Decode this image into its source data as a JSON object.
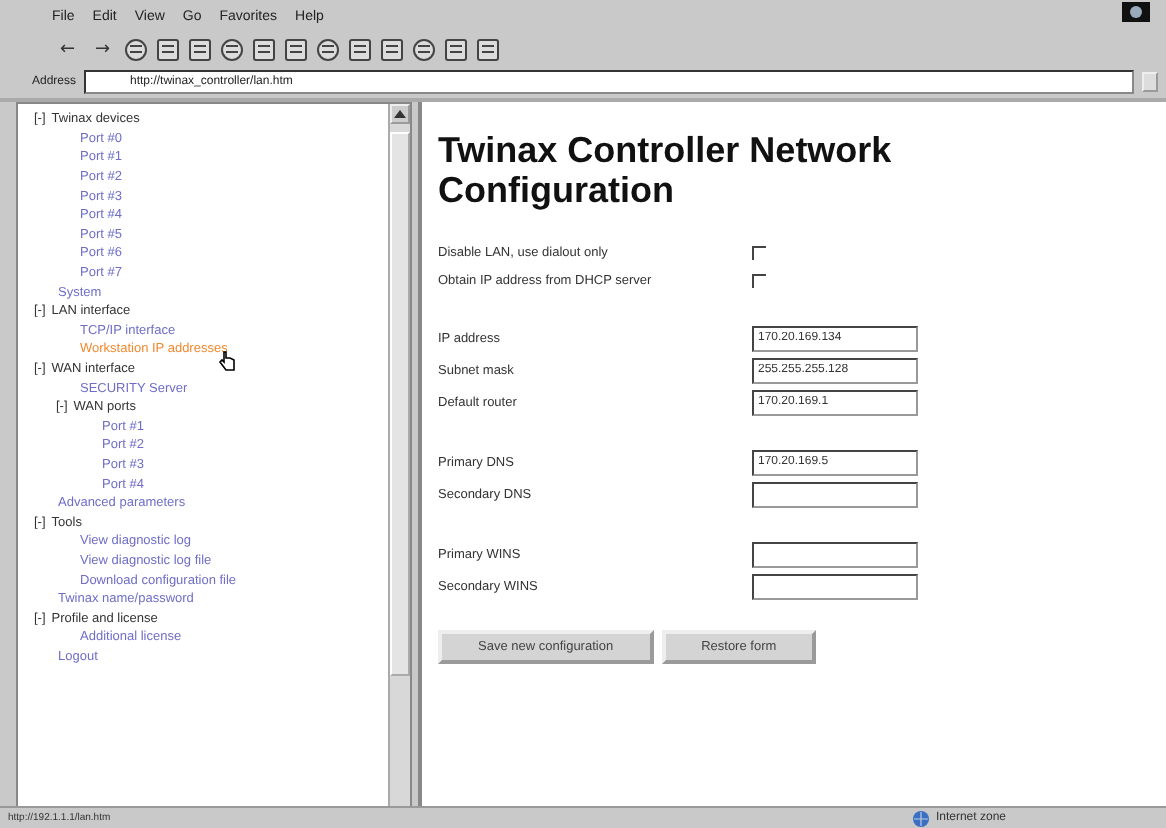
{
  "menu": [
    "File",
    "Edit",
    "View",
    "Go",
    "Favorites",
    "Help"
  ],
  "toolbar": {
    "back": "←",
    "forward": "→"
  },
  "address": {
    "label": "Address",
    "value": "http://twinax_controller/lan.htm"
  },
  "tree": [
    {
      "label": "Twinax devices",
      "toggle": "[-]",
      "selected": false,
      "children": [
        {
          "label": "Port #0",
          "selected": false
        },
        {
          "label": "Port #1",
          "selected": false
        },
        {
          "label": "Port #2",
          "selected": false
        },
        {
          "label": "Port #3",
          "selected": false
        },
        {
          "label": "Port #4",
          "selected": false
        },
        {
          "label": "Port #5",
          "selected": false
        },
        {
          "label": "Port #6",
          "selected": false
        },
        {
          "label": "Port #7",
          "selected": false
        }
      ]
    },
    {
      "label": "System",
      "selected": false
    },
    {
      "label": "LAN interface",
      "toggle": "[-]",
      "selected": false,
      "children": [
        {
          "label": "TCP/IP interface",
          "selected": false
        },
        {
          "label": "Workstation IP addresses",
          "selected": true
        }
      ]
    },
    {
      "label": "WAN interface",
      "toggle": "[-]",
      "selected": false,
      "children": [
        {
          "label": "SECURITY Server",
          "selected": false
        },
        {
          "label": "WAN ports",
          "toggle": "[-]",
          "selected": false,
          "children": [
            {
              "label": "Port #1",
              "selected": false
            },
            {
              "label": "Port #2",
              "selected": false
            },
            {
              "label": "Port #3",
              "selected": false
            },
            {
              "label": "Port #4",
              "selected": false
            }
          ]
        }
      ]
    },
    {
      "label": "Advanced parameters",
      "selected": false
    },
    {
      "label": "Tools",
      "toggle": "[-]",
      "selected": false,
      "children": [
        {
          "label": "View diagnostic log",
          "selected": false
        },
        {
          "label": "View diagnostic log file",
          "selected": false
        },
        {
          "label": "Download configuration file",
          "selected": false
        }
      ]
    },
    {
      "label": "Twinax name/password",
      "selected": false
    },
    {
      "label": "Profile and license",
      "toggle": "[-]",
      "selected": false,
      "children": [
        {
          "label": "Additional license",
          "selected": false
        }
      ]
    },
    {
      "label": "Logout",
      "selected": false
    }
  ],
  "title": "Twinax Controller Network Configuration",
  "checkboxes": [
    {
      "label": "Disable LAN, use dialout only",
      "checked": false
    },
    {
      "label": "Obtain IP address from DHCP server",
      "checked": false
    }
  ],
  "field_groups": [
    [
      {
        "label": "IP address",
        "value": "170.20.169.134"
      },
      {
        "label": "Subnet mask",
        "value": "255.255.255.128"
      },
      {
        "label": "Default router",
        "value": "170.20.169.1"
      }
    ],
    [
      {
        "label": "Primary DNS",
        "value": "170.20.169.5"
      },
      {
        "label": "Secondary DNS"
      }
    ],
    [
      {
        "label": "Primary WINS"
      },
      {
        "label": "Secondary WINS"
      }
    ]
  ],
  "buttons": [
    "Save new configuration",
    "Restore form"
  ],
  "status_bar": {
    "url": "http://192.1.1.1/lan.htm",
    "zone": "Internet zone"
  }
}
